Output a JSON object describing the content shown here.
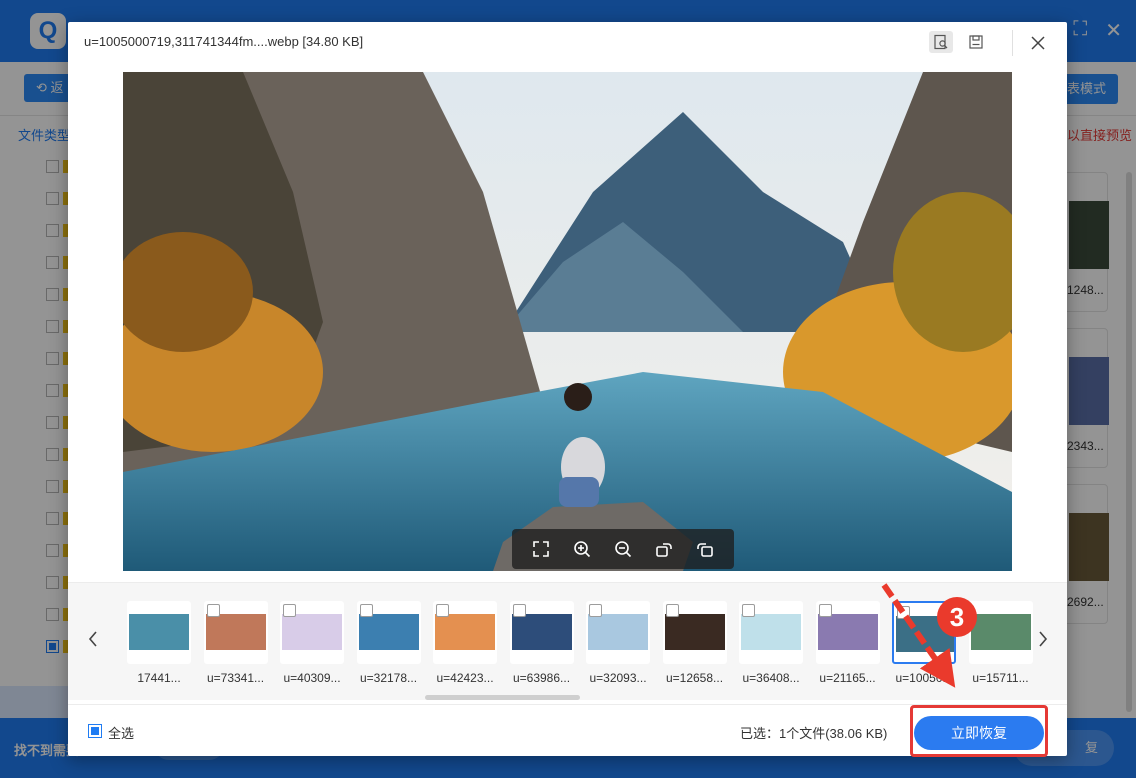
{
  "app": {
    "logo_letter": "Q",
    "back_label": "返",
    "mode_label": "表模式",
    "file_type_label": "文件类型",
    "preview_tip": "可以直接预览",
    "right_thumb_labels": [
      "1248...",
      "2343...",
      "2692..."
    ],
    "footer_text": "找不到需要",
    "footer_recover_label": "复",
    "header_icons": [
      "⛶",
      "✕"
    ]
  },
  "dialog": {
    "title": "u=1005000719,311741344fm....webp [34.80 KB]",
    "tools": {
      "preview_icon": "preview-icon",
      "save_icon": "save-icon",
      "close_icon": "close-icon"
    }
  },
  "image_toolbar": [
    "fullscreen-icon",
    "zoom-in-icon",
    "zoom-out-icon",
    "rotate-right-icon",
    "rotate-left-icon"
  ],
  "thumbnails": [
    {
      "label": "17441...",
      "checkbox": false,
      "selected": false,
      "color": "#4a8fa8"
    },
    {
      "label": "u=73341...",
      "checkbox": true,
      "selected": false,
      "color": "#c0785a"
    },
    {
      "label": "u=40309...",
      "checkbox": true,
      "selected": false,
      "color": "#d8cce8"
    },
    {
      "label": "u=32178...",
      "checkbox": true,
      "selected": false,
      "color": "#3c7fb0"
    },
    {
      "label": "u=42423...",
      "checkbox": true,
      "selected": false,
      "color": "#e49050"
    },
    {
      "label": "u=63986...",
      "checkbox": true,
      "selected": false,
      "color": "#2d4d7a"
    },
    {
      "label": "u=32093...",
      "checkbox": true,
      "selected": false,
      "color": "#a9c8e0"
    },
    {
      "label": "u=12658...",
      "checkbox": true,
      "selected": false,
      "color": "#3a2a22"
    },
    {
      "label": "u=36408...",
      "checkbox": true,
      "selected": false,
      "color": "#bfe0ea"
    },
    {
      "label": "u=21165...",
      "checkbox": true,
      "selected": false,
      "color": "#8a7ab0"
    },
    {
      "label": "u=10050...",
      "checkbox": true,
      "selected": true,
      "color": "#3b6f86"
    },
    {
      "label": "u=15711...",
      "checkbox": false,
      "selected": false,
      "color": "#5a8a6a"
    }
  ],
  "footer": {
    "select_all_label": "全选",
    "selected_info": "已选：1个文件(38.06 KB)",
    "recover_label": "立即恢复"
  },
  "annotation": {
    "step_number": "3",
    "color": "#ea3a2c"
  },
  "colors": {
    "accent": "#2b7bf0",
    "highlight": "#e53935"
  }
}
